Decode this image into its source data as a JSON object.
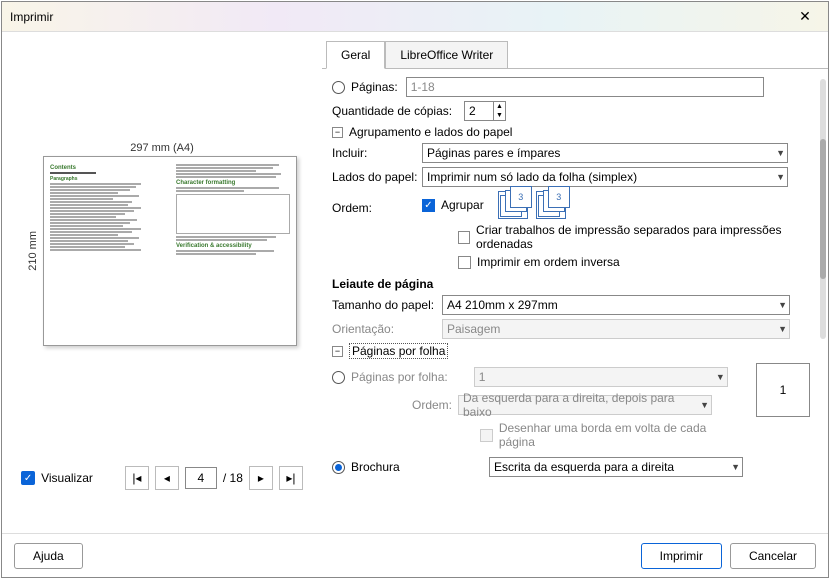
{
  "title": "Imprimir",
  "tabs": {
    "general": "Geral",
    "writer": "LibreOffice Writer"
  },
  "range": {
    "pages_label": "Páginas:",
    "pages_value": "1-18",
    "copies_label": "Quantidade de cópias:",
    "copies_value": "2",
    "collation_group": "Agrupamento e lados do papel",
    "include_label": "Incluir:",
    "include_value": "Páginas pares e ímpares",
    "sides_label": "Lados do papel:",
    "sides_value": "Imprimir num só lado da folha (simplex)",
    "order_label": "Ordem:",
    "collate": "Agrupar",
    "separate": "Criar trabalhos de impressão separados para impressões ordenadas",
    "reverse": "Imprimir em ordem inversa"
  },
  "layout": {
    "heading": "Leiaute de página",
    "paper_size_label": "Tamanho do papel:",
    "paper_size_value": "A4 210mm x 297mm",
    "orientation_label": "Orientação:",
    "orientation_value": "Paisagem",
    "ppf_group": "Páginas por folha",
    "ppf_label": "Páginas por folha:",
    "ppf_value": "1",
    "ppf_order_label": "Ordem:",
    "ppf_order_value": "Da esquerda para a direita, depois para baixo",
    "draw_border": "Desenhar uma borda em volta de cada página",
    "brochure_label": "Brochura",
    "brochure_value": "Escrita da esquerda para a direita",
    "preview_number": "1"
  },
  "preview": {
    "top_label": "297 mm (A4)",
    "left_label": "210 mm",
    "show_label": "Visualizar",
    "page": "4",
    "total": "/ 18"
  },
  "buttons": {
    "help": "Ajuda",
    "print": "Imprimir",
    "cancel": "Cancelar"
  }
}
